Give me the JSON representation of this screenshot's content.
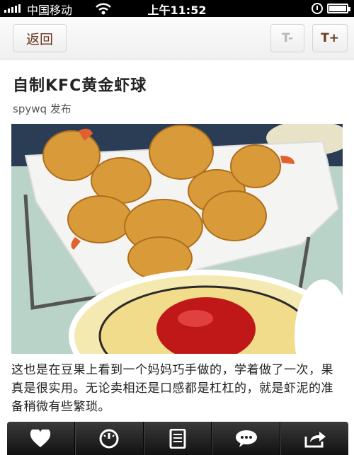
{
  "status_bar": {
    "carrier": "中国移动",
    "time": "上午11:52"
  },
  "nav": {
    "back_label": "返回",
    "font_decrease_label": "T-",
    "font_increase_label": "T+"
  },
  "article": {
    "title": "自制KFC黄金虾球",
    "author_line": "spywq 发布",
    "body": "这也是在豆果上看到一个妈妈巧手做的，学着做了一次，果真是很实用。无论卖相还是口感都是杠杠的，就是虾泥的准备稍微有些繁琐。"
  },
  "tab_bar": {
    "items": [
      "heart-icon",
      "gauge-icon",
      "document-icon",
      "chat-bubble-icon",
      "share-icon"
    ]
  },
  "colors": {
    "accent": "#6b3a1f",
    "tab_bar": "#1e1e1e",
    "status_bar": "#000000"
  }
}
